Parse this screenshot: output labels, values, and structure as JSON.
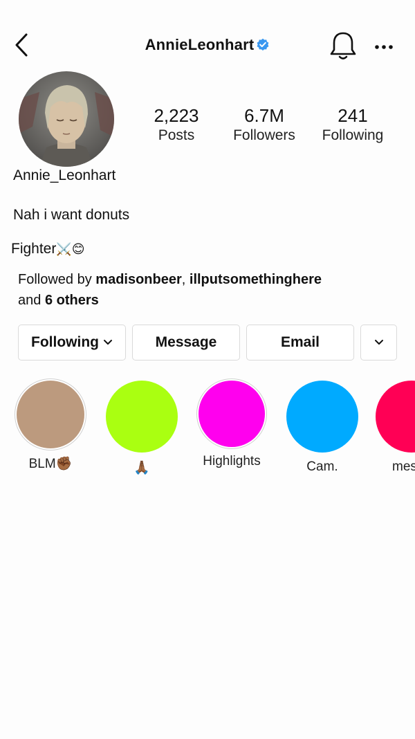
{
  "header": {
    "title": "AnnieLeonhart",
    "verified": true
  },
  "stats": {
    "posts_value": "2,223",
    "posts_label": "Posts",
    "followers_value": "6.7M",
    "followers_label": "Followers",
    "following_value": "241",
    "following_label": "Following"
  },
  "profile": {
    "username": "Annie_Leonhart",
    "bio": "Nah i want donuts",
    "tagline": "Fighter",
    "tagline_emoji": "⚔️😊"
  },
  "followed_by": {
    "prefix": "Followed by ",
    "user1": "madisonbeer",
    "separator": ", ",
    "user2": "illputsomethinghere",
    "and": "and ",
    "others": "6 others"
  },
  "actions": {
    "following_label": "Following",
    "message_label": "Message",
    "email_label": "Email"
  },
  "highlights": [
    {
      "label": "BLM✊🏾",
      "color": "#bc9a7e"
    },
    {
      "label": "🙏🏾",
      "color": "#aaff11"
    },
    {
      "label": "Highlights",
      "color": "#ff00ee"
    },
    {
      "label": "Cam.",
      "color": "#00aaff"
    },
    {
      "label": "messe",
      "color": "#ff0055"
    }
  ],
  "colors": {
    "verified_badge": "#3897f0",
    "button_border": "#dadada"
  }
}
